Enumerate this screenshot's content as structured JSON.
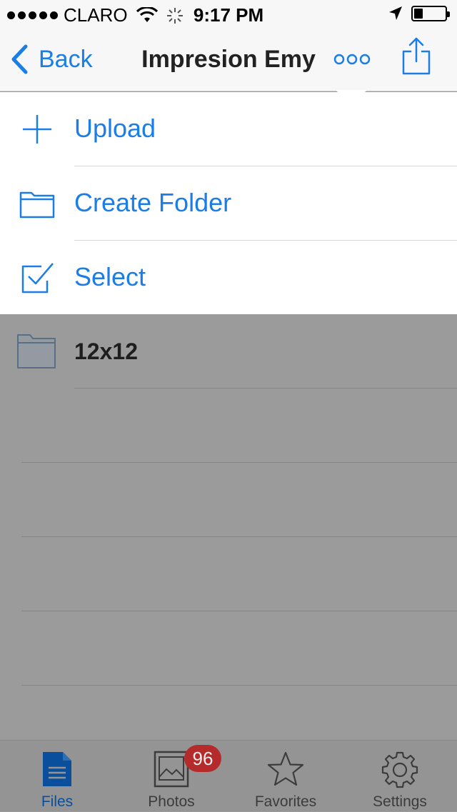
{
  "status_bar": {
    "carrier": "CLARO",
    "time": "9:17 PM"
  },
  "nav": {
    "back_label": "Back",
    "title": "Impresion Emy"
  },
  "menu": {
    "items": [
      {
        "label": "Upload",
        "icon": "plus-icon"
      },
      {
        "label": "Create Folder",
        "icon": "folder-icon"
      },
      {
        "label": "Select",
        "icon": "checkbox-icon"
      }
    ]
  },
  "files": [
    {
      "name": "12x12",
      "icon": "folder-icon"
    }
  ],
  "tab_bar": {
    "tabs": [
      {
        "label": "Files",
        "icon": "document-icon",
        "active": true
      },
      {
        "label": "Photos",
        "icon": "photo-icon",
        "badge": "96"
      },
      {
        "label": "Favorites",
        "icon": "star-icon"
      },
      {
        "label": "Settings",
        "icon": "gear-icon"
      }
    ]
  },
  "colors": {
    "accent": "#1a7ee6",
    "badge": "#b52a2a",
    "overlay": "#9b9b9b"
  }
}
